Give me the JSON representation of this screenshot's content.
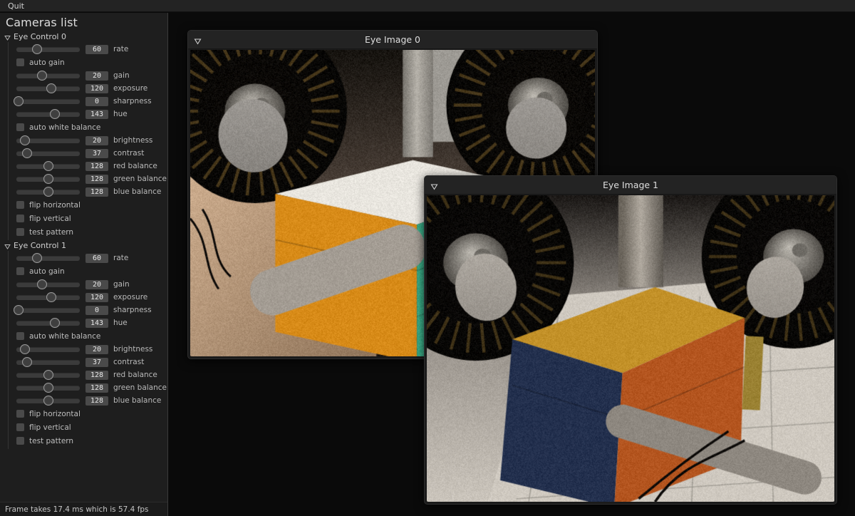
{
  "menubar": {
    "quit_label": "Quit"
  },
  "panel": {
    "title": "Cameras list",
    "groups": [
      {
        "name": "Eye Control 0",
        "label": "Eye Control 0",
        "expanded": true,
        "rows": [
          {
            "kind": "slider",
            "label": "rate",
            "value": "60",
            "pos": 0.33,
            "checked": false
          },
          {
            "kind": "checkbox",
            "label": "auto gain",
            "value": "",
            "pos": 0,
            "checked": false
          },
          {
            "kind": "slider",
            "label": "gain",
            "value": "20",
            "pos": 0.4,
            "checked": false
          },
          {
            "kind": "slider",
            "label": "exposure",
            "value": "120",
            "pos": 0.55,
            "checked": false
          },
          {
            "kind": "slider",
            "label": "sharpness",
            "value": "0",
            "pos": 0.03,
            "checked": false
          },
          {
            "kind": "slider",
            "label": "hue",
            "value": "143",
            "pos": 0.61,
            "checked": false
          },
          {
            "kind": "checkbox",
            "label": "auto white balance",
            "value": "",
            "pos": 0,
            "checked": false
          },
          {
            "kind": "slider",
            "label": "brightness",
            "value": "20",
            "pos": 0.13,
            "checked": false
          },
          {
            "kind": "slider",
            "label": "contrast",
            "value": "37",
            "pos": 0.17,
            "checked": false
          },
          {
            "kind": "slider",
            "label": "red balance",
            "value": "128",
            "pos": 0.5,
            "checked": false
          },
          {
            "kind": "slider",
            "label": "green balance",
            "value": "128",
            "pos": 0.5,
            "checked": false
          },
          {
            "kind": "slider",
            "label": "blue balance",
            "value": "128",
            "pos": 0.5,
            "checked": false
          },
          {
            "kind": "checkbox",
            "label": "flip horizontal",
            "value": "",
            "pos": 0,
            "checked": false
          },
          {
            "kind": "checkbox",
            "label": "flip vertical",
            "value": "",
            "pos": 0,
            "checked": false
          },
          {
            "kind": "checkbox",
            "label": "test pattern",
            "value": "",
            "pos": 0,
            "checked": false
          }
        ]
      },
      {
        "name": "Eye Control 1",
        "label": "Eye Control 1",
        "expanded": true,
        "rows": [
          {
            "kind": "slider",
            "label": "rate",
            "value": "60",
            "pos": 0.33,
            "checked": false
          },
          {
            "kind": "checkbox",
            "label": "auto gain",
            "value": "",
            "pos": 0,
            "checked": false
          },
          {
            "kind": "slider",
            "label": "gain",
            "value": "20",
            "pos": 0.4,
            "checked": false
          },
          {
            "kind": "slider",
            "label": "exposure",
            "value": "120",
            "pos": 0.55,
            "checked": false
          },
          {
            "kind": "slider",
            "label": "sharpness",
            "value": "0",
            "pos": 0.03,
            "checked": false
          },
          {
            "kind": "slider",
            "label": "hue",
            "value": "143",
            "pos": 0.61,
            "checked": false
          },
          {
            "kind": "checkbox",
            "label": "auto white balance",
            "value": "",
            "pos": 0,
            "checked": false
          },
          {
            "kind": "slider",
            "label": "brightness",
            "value": "20",
            "pos": 0.13,
            "checked": false
          },
          {
            "kind": "slider",
            "label": "contrast",
            "value": "37",
            "pos": 0.17,
            "checked": false
          },
          {
            "kind": "slider",
            "label": "red balance",
            "value": "128",
            "pos": 0.5,
            "checked": false
          },
          {
            "kind": "slider",
            "label": "green balance",
            "value": "128",
            "pos": 0.5,
            "checked": false
          },
          {
            "kind": "slider",
            "label": "blue balance",
            "value": "128",
            "pos": 0.5,
            "checked": false
          },
          {
            "kind": "checkbox",
            "label": "flip horizontal",
            "value": "",
            "pos": 0,
            "checked": false
          },
          {
            "kind": "checkbox",
            "label": "flip vertical",
            "value": "",
            "pos": 0,
            "checked": false
          },
          {
            "kind": "checkbox",
            "label": "test pattern",
            "value": "",
            "pos": 0,
            "checked": false
          }
        ]
      }
    ]
  },
  "statusbar": {
    "text": "Frame takes 17.4 ms which is 57.4 fps"
  },
  "windows": [
    {
      "id": "win0",
      "title": "Eye Image 0",
      "collapse_icon": "triangle-down-icon"
    },
    {
      "id": "win1",
      "title": "Eye Image 1",
      "collapse_icon": "triangle-down-icon"
    }
  ],
  "colors": {
    "app_background": "#0a0a0a",
    "panel_background": "#1e1e1e",
    "titlebar_background": "#232323",
    "text_primary": "#dedede",
    "text_secondary": "#b9b9b9",
    "slider_track": "#3b3b3b",
    "value_box": "#4a4a4a"
  },
  "scene": {
    "eye_image_0": {
      "description": "close-up camera view of an orange, white and green foam cube held between two silver robot grippers with black spoked wheels behind, wooden table in foreground",
      "palette": {
        "cube_orange": "#d88b18",
        "cube_white": "#e9e6df",
        "cube_green": "#3cb08a",
        "wheel_black": "#0d0a07",
        "metal_gray": "#9d9a94",
        "wood_tan": "#c2a184"
      }
    },
    "eye_image_1": {
      "description": "close-up camera view of an orange-brown and dark blue cube between silver robot arms, black spoked wheels left and right, bright tiled floor behind",
      "palette": {
        "cube_orange": "#b4551f",
        "cube_yellow": "#c39128",
        "cube_blue": "#23304e",
        "wheel_black": "#0b0908",
        "metal_gray": "#b9b4ad",
        "floor_light": "#cfc9c0"
      }
    }
  }
}
